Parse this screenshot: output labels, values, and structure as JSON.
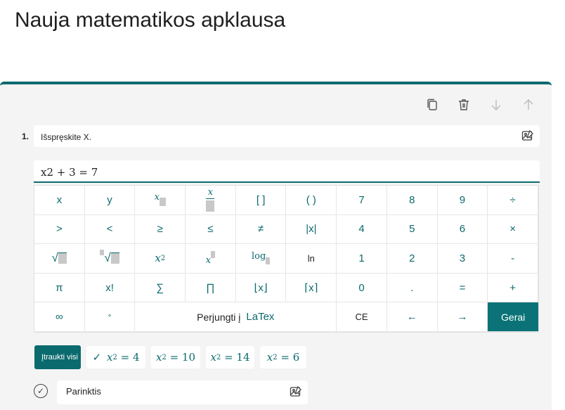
{
  "page": {
    "title": "Nauja matematikos apklausa"
  },
  "question": {
    "number": "1.",
    "text": "Išspręskite X.",
    "expression": "x2 + 3 = 7"
  },
  "toolbar": {
    "icons": [
      "copy-icon",
      "trash-icon",
      "arrow-down-icon",
      "arrow-up-icon"
    ]
  },
  "keypad": {
    "row1": {
      "x": "x",
      "y": "y",
      "open_bracket": "[ ]",
      "open_paren": "( )",
      "k7": "7",
      "k8": "8",
      "k9": "9",
      "div": "÷",
      "sub_x": "x",
      "frac_x": "x"
    },
    "row2": {
      "gt": ">",
      "lt": "<",
      "ge": "≥",
      "le": "≤",
      "ne": "≠",
      "abs": "|x|",
      "k4": "4",
      "k5": "5",
      "k6": "6",
      "mul": "×"
    },
    "row3": {
      "sqrt": "√",
      "nroot": "√",
      "sq_base": "x",
      "sq_exp": "2",
      "pow_base": "x",
      "log": "log",
      "ln": "ln",
      "k1": "1",
      "k2": "2",
      "k3": "3",
      "minus": "-"
    },
    "row4": {
      "pi": "π",
      "fact": "x!",
      "sum": "∑",
      "prod": "∏",
      "floor": "⌊x⌋",
      "ceil": "⌈x⌉",
      "k0": "0",
      "dot": ".",
      "eq": "=",
      "plus": "+"
    },
    "row5": {
      "inf": "∞",
      "deg": "°",
      "toggle": "Perjungti į",
      "latex": "LaTex",
      "ce": "CE",
      "left": "←",
      "right": "→",
      "done": "Gerai"
    }
  },
  "answers": {
    "insert_label": "Įtraukti visi",
    "chips": [
      {
        "checked": true,
        "base": "x",
        "sub": "2",
        "rest": " = 4"
      },
      {
        "checked": false,
        "base": "x",
        "sub": "2",
        "rest": " = 10"
      },
      {
        "checked": false,
        "base": "x",
        "sub": "2",
        "rest": " = 14"
      },
      {
        "checked": false,
        "base": "x",
        "sub": "2",
        "rest": " = 6"
      }
    ]
  },
  "option": {
    "placeholder": "Parinktis"
  },
  "colors": {
    "accent": "#0b6a6e",
    "background": "#f4f4f4"
  }
}
